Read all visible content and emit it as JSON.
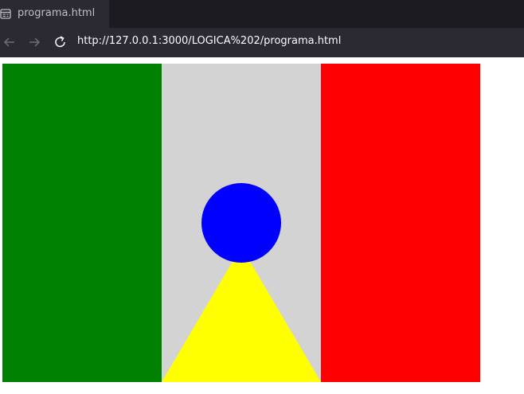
{
  "browser": {
    "tab_title": "programa.html",
    "url": "http://127.0.0.1:3000/LOGICA%202/programa.html",
    "tab_icon": "page-icon",
    "back_icon": "back-arrow-icon",
    "forward_icon": "forward-arrow-icon",
    "reload_icon": "reload-icon"
  },
  "flag": {
    "colors": {
      "left_stripe": "#008000",
      "middle_stripe": "#d3d3d3",
      "right_stripe": "#ff0000",
      "circle": "#0000ff",
      "triangle": "#ffff00"
    }
  }
}
